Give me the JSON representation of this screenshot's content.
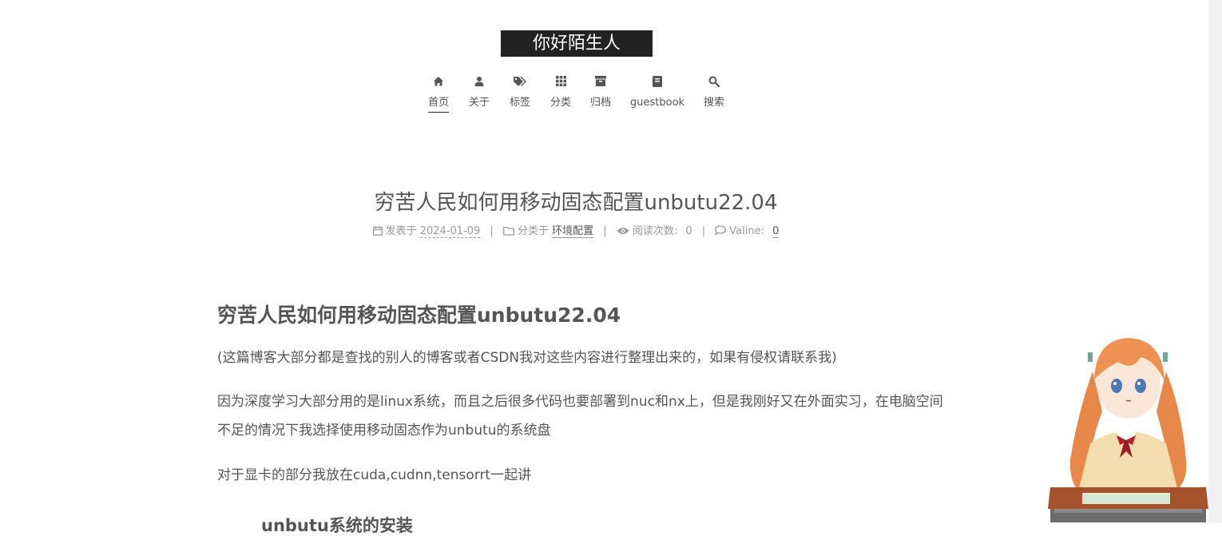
{
  "site": {
    "title": "你好陌生人"
  },
  "menu": [
    {
      "label": "首页",
      "icon": "home-icon",
      "active": true
    },
    {
      "label": "关于",
      "icon": "user-icon"
    },
    {
      "label": "标签",
      "icon": "tags-icon"
    },
    {
      "label": "分类",
      "icon": "th-icon"
    },
    {
      "label": "归档",
      "icon": "archive-icon"
    },
    {
      "label": "guestbook",
      "icon": "book-icon"
    },
    {
      "label": "搜索",
      "icon": "search-icon"
    }
  ],
  "post": {
    "title": "穷苦人民如何用移动固态配置unbutu22.04",
    "meta": {
      "posted_label": "发表于",
      "date": "2024-01-09",
      "category_label": "分类于",
      "category": "环境配置",
      "views_label": "阅读次数:",
      "views": "0",
      "comments_label": "Valine:",
      "comments": "0"
    },
    "heading": "穷苦人民如何用移动固态配置unbutu22.04",
    "paragraphs": [
      "(这篇博客大部分都是查找的别人的博客或者CSDN我对这些内容进行整理出来的，如果有侵权请联系我)",
      "因为深度学习大部分用的是linux系统，而且之后很多代码也要部署到nuc和nx上，但是我刚好又在外面实习，在电脑空间不足的情况下我选择使用移动固态作为unbutu的系统盘",
      "对于显卡的部分我放在cuda,cudnn,tensorrt一起讲"
    ],
    "subheading_partial": "unbutu系统的安装"
  },
  "colors": {
    "title_bg": "#222222",
    "text": "#555555",
    "meta": "#999999"
  }
}
